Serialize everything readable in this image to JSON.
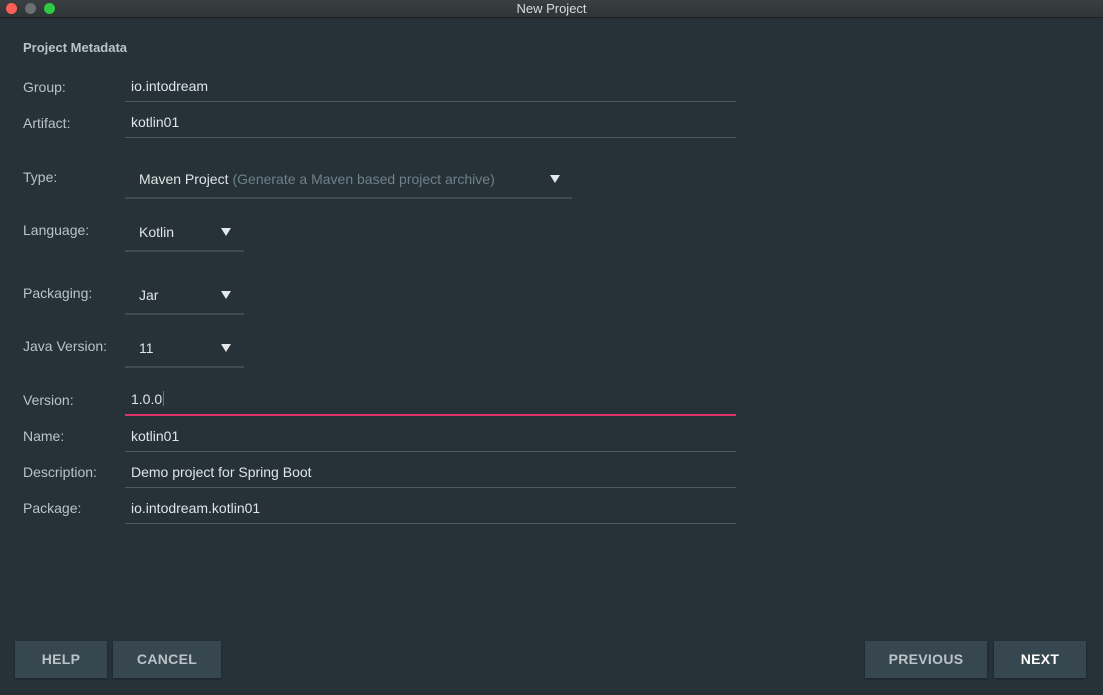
{
  "window": {
    "title": "New Project"
  },
  "section": {
    "title": "Project Metadata"
  },
  "fields": {
    "group": {
      "label": "Group:",
      "value": "io.intodream"
    },
    "artifact": {
      "label": "Artifact:",
      "value": "kotlin01"
    },
    "type": {
      "label": "Type:",
      "value": "Maven Project",
      "hint": "(Generate a Maven based project archive)"
    },
    "language": {
      "label": "Language:",
      "value": "Kotlin"
    },
    "packaging": {
      "label": "Packaging:",
      "value": "Jar"
    },
    "java_version": {
      "label": "Java Version:",
      "value": "11"
    },
    "version": {
      "label": "Version:",
      "value": "1.0.0"
    },
    "name": {
      "label": "Name:",
      "value": "kotlin01"
    },
    "description": {
      "label": "Description:",
      "value": "Demo project for Spring Boot"
    },
    "package": {
      "label": "Package:",
      "value": "io.intodream.kotlin01"
    }
  },
  "buttons": {
    "help": "HELP",
    "cancel": "CANCEL",
    "previous": "PREVIOUS",
    "next": "NEXT"
  },
  "colors": {
    "background": "#263238",
    "button": "#37474f",
    "accent_underline": "#e0336c",
    "label": "#b9c3c8",
    "value": "#dfe5e8",
    "hint": "#6f8189"
  },
  "icons": {
    "dropdown_arrow": "triangle-down"
  }
}
